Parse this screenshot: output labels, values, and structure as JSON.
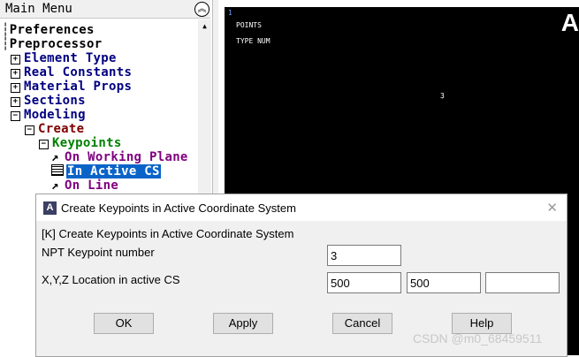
{
  "menu": {
    "title": "Main Menu",
    "collapse_icon": "double-chevron-up-icon",
    "items": [
      {
        "label": "Preferences",
        "box": ""
      },
      {
        "label": "Preprocessor",
        "box": ""
      },
      {
        "label": "Element Type",
        "box": "+"
      },
      {
        "label": "Real Constants",
        "box": "+"
      },
      {
        "label": "Material Props",
        "box": "+"
      },
      {
        "label": "Sections",
        "box": "+"
      },
      {
        "label": "Modeling",
        "box": "−"
      },
      {
        "label": "Create",
        "box": "−"
      },
      {
        "label": "Keypoints",
        "box": "−"
      },
      {
        "label": "On Working Plane",
        "icon": "arrow-icon"
      },
      {
        "label": "In Active CS",
        "icon": "grid-icon"
      },
      {
        "label": "On Line",
        "icon": "arrow-icon"
      }
    ]
  },
  "graphics": {
    "window_number": "1",
    "label_points": "POINTS",
    "label_type": "TYPE NUM",
    "keypoint_label": "3",
    "logo_letter": "A"
  },
  "dialog": {
    "title": "Create Keypoints in Active Coordinate System",
    "icon_letter": "A",
    "heading": "[K]  Create Keypoints in Active Coordinate System",
    "npt_label": "NPT    Keypoint number",
    "npt_value": "3",
    "xyz_label": "X,Y,Z  Location in active CS",
    "x_value": "500",
    "y_value": "500",
    "z_value": "",
    "ok_label": "OK",
    "apply_label": "Apply",
    "cancel_label": "Cancel",
    "help_label": "Help",
    "close_glyph": "✕"
  },
  "watermark": "CSDN @m0_68459511",
  "colors": {
    "selection": "#0a64c8",
    "nav_text": "#000080",
    "create_text": "#800000",
    "keypoints_text": "#008000",
    "leaf_text": "#800080"
  }
}
